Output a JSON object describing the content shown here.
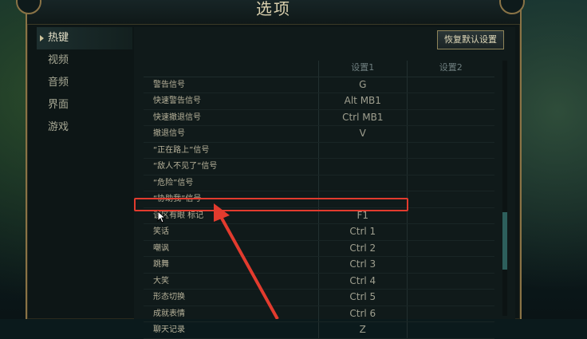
{
  "window": {
    "title": "选项"
  },
  "sidebar": {
    "items": [
      {
        "label": "热键",
        "active": true
      },
      {
        "label": "视频"
      },
      {
        "label": "音频"
      },
      {
        "label": "界面"
      },
      {
        "label": "游戏"
      }
    ]
  },
  "toolbar": {
    "reset_label": "恢复默认设置"
  },
  "table": {
    "headers": [
      "",
      "设置1",
      "设置2"
    ],
    "rows": [
      {
        "action": "警告信号",
        "set1": "G",
        "set2": ""
      },
      {
        "action": "快速警告信号",
        "set1": "Alt  MB1",
        "set2": ""
      },
      {
        "action": "快速撤退信号",
        "set1": "Ctrl  MB1",
        "set2": ""
      },
      {
        "action": "撤退信号",
        "set1": "V",
        "set2": ""
      },
      {
        "action": "“正在路上”信号",
        "set1": "",
        "set2": ""
      },
      {
        "action": "“敌人不见了”信号",
        "set1": "",
        "set2": ""
      },
      {
        "action": "“危险”信号",
        "set1": "",
        "set2": ""
      },
      {
        "action": "“协助我”信号",
        "set1": "",
        "set2": ""
      },
      {
        "action": "该区有眼 标记",
        "set1": "F1",
        "set2": ""
      },
      {
        "action": "笑话",
        "set1": "Ctrl  1",
        "set2": ""
      },
      {
        "action": "嘲讽",
        "set1": "Ctrl  2",
        "set2": ""
      },
      {
        "action": "跳舞",
        "set1": "Ctrl  3",
        "set2": ""
      },
      {
        "action": "大笑",
        "set1": "Ctrl  4",
        "set2": ""
      },
      {
        "action": "形态切换",
        "set1": "Ctrl  5",
        "set2": ""
      },
      {
        "action": "成就表情",
        "set1": "Ctrl  6",
        "set2": ""
      },
      {
        "action": "聊天记录",
        "set1": "Z",
        "set2": ""
      }
    ]
  },
  "colors": {
    "highlight": "#e23b2e",
    "accent": "#8e8459"
  }
}
